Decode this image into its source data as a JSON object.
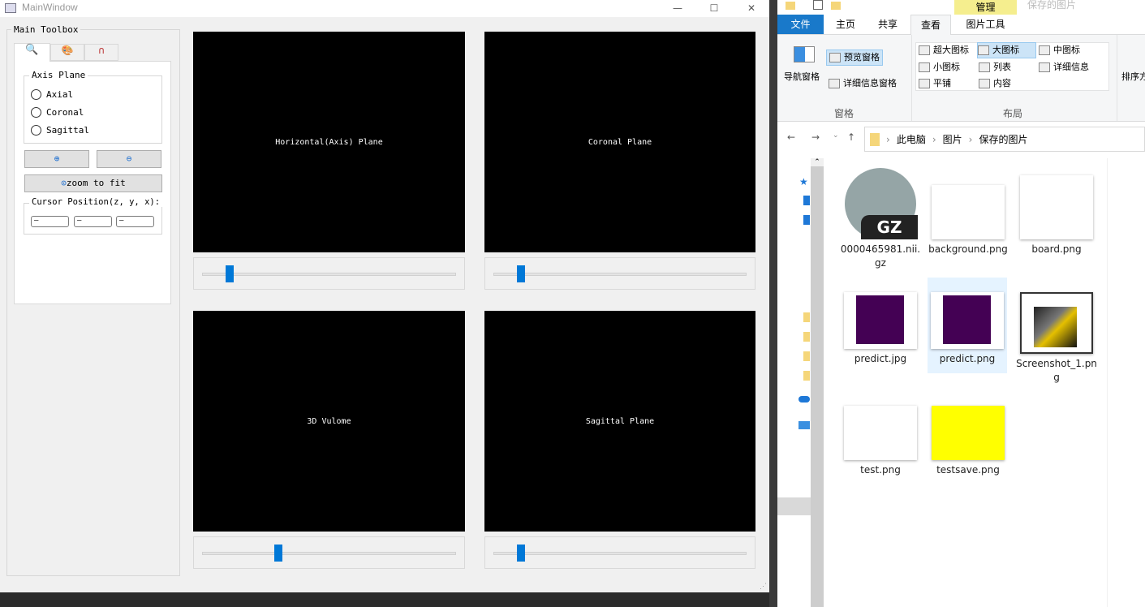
{
  "main_window": {
    "title": "MainWindow",
    "toolbox": {
      "title": "Main Toolbox",
      "tabs": [
        {
          "icon": "zoom-icon"
        },
        {
          "icon": "paint-icon"
        },
        {
          "icon": "magnet-icon"
        }
      ],
      "axis_plane": {
        "title": "Axis Plane",
        "options": [
          "Axial",
          "Coronal",
          "Sagittal"
        ]
      },
      "zoom_to_fit": "zoom to fit",
      "cursor": {
        "title": "Cursor Position(z, y, x):",
        "values": [
          "—",
          "—",
          "—"
        ]
      }
    },
    "views": [
      {
        "label": "Horizontal(Axis) Plane",
        "slider": 0.11
      },
      {
        "label": "Coronal Plane",
        "slider": 0.11
      },
      {
        "label": "3D Vulome",
        "slider": 0.3
      },
      {
        "label": "Sagittal Plane",
        "slider": 0.11
      }
    ]
  },
  "explorer": {
    "title": "保存的图片",
    "context_tab_group": "管理",
    "tabs": [
      "文件",
      "主页",
      "共享",
      "查看",
      "图片工具"
    ],
    "pane": {
      "nav": "导航窗格",
      "preview": "预览窗格",
      "details": "详细信息窗格",
      "group": "窗格"
    },
    "layout": {
      "items": [
        "超大图标",
        "大图标",
        "中图标",
        "小图标",
        "列表",
        "详细信息",
        "平铺",
        "内容"
      ],
      "group": "布局"
    },
    "sort": "排序方",
    "breadcrumb": [
      "此电脑",
      "图片",
      "保存的图片"
    ],
    "files": [
      {
        "name": "0000465981.nii.gz",
        "badge": "GZ"
      },
      {
        "name": "background.png"
      },
      {
        "name": "board.png"
      },
      {
        "name": "predict.jpg"
      },
      {
        "name": "predict.png"
      },
      {
        "name": "Screenshot_1.png"
      },
      {
        "name": "test.png"
      },
      {
        "name": "testsave.png"
      }
    ]
  }
}
